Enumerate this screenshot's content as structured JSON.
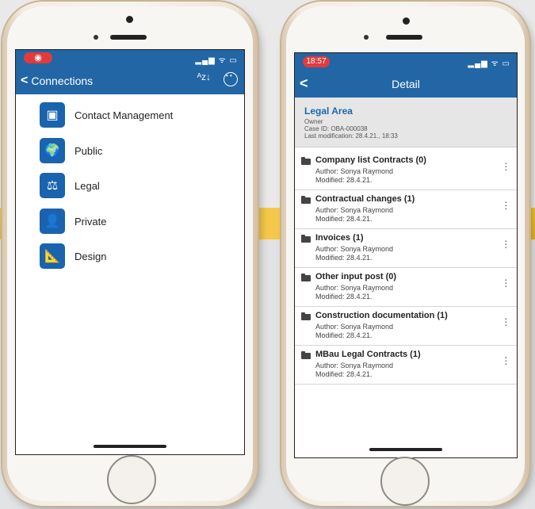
{
  "left": {
    "status": {
      "record_icon": "record-icon"
    },
    "nav": {
      "back_label": "Connections",
      "sort_icon": "sort-az-icon",
      "more_icon": "more-circle-icon"
    },
    "items": [
      {
        "label": "Contact Management",
        "icon": "contact-card-icon",
        "glyph": "▣"
      },
      {
        "label": "Public",
        "icon": "globe-icon",
        "glyph": "🌍"
      },
      {
        "label": "Legal",
        "icon": "scales-icon",
        "glyph": "⚖"
      },
      {
        "label": "Private",
        "icon": "person-lock-icon",
        "glyph": "👤"
      },
      {
        "label": "Design",
        "icon": "ruler-triangle-icon",
        "glyph": "📐"
      }
    ]
  },
  "right": {
    "status": {
      "time": "18:57"
    },
    "nav": {
      "title": "Detail"
    },
    "area": {
      "title": "Legal Area",
      "role": "Owner",
      "case_id": "Case ID: OBA-000038",
      "last_mod": "Last modification: 28.4.21., 18:33"
    },
    "folders": [
      {
        "name": "Company list Contracts (0)",
        "author": "Author: Sonya Raymond",
        "modified": "Modified: 28.4.21."
      },
      {
        "name": "Contractual changes (1)",
        "author": "Author: Sonya Raymond",
        "modified": "Modified: 28.4.21."
      },
      {
        "name": "Invoices (1)",
        "author": "Author: Sonya Raymond",
        "modified": "Modified: 28.4.21."
      },
      {
        "name": "Other input post (0)",
        "author": "Author: Sonya Raymond",
        "modified": "Modified: 28.4.21."
      },
      {
        "name": "Construction documentation (1)",
        "author": "Author: Sonya Raymond",
        "modified": "Modified: 28.4.21."
      },
      {
        "name": "MBau Legal Contracts (1)",
        "author": "Author: Sonya Raymond",
        "modified": "Modified: 28.4.21."
      }
    ]
  }
}
